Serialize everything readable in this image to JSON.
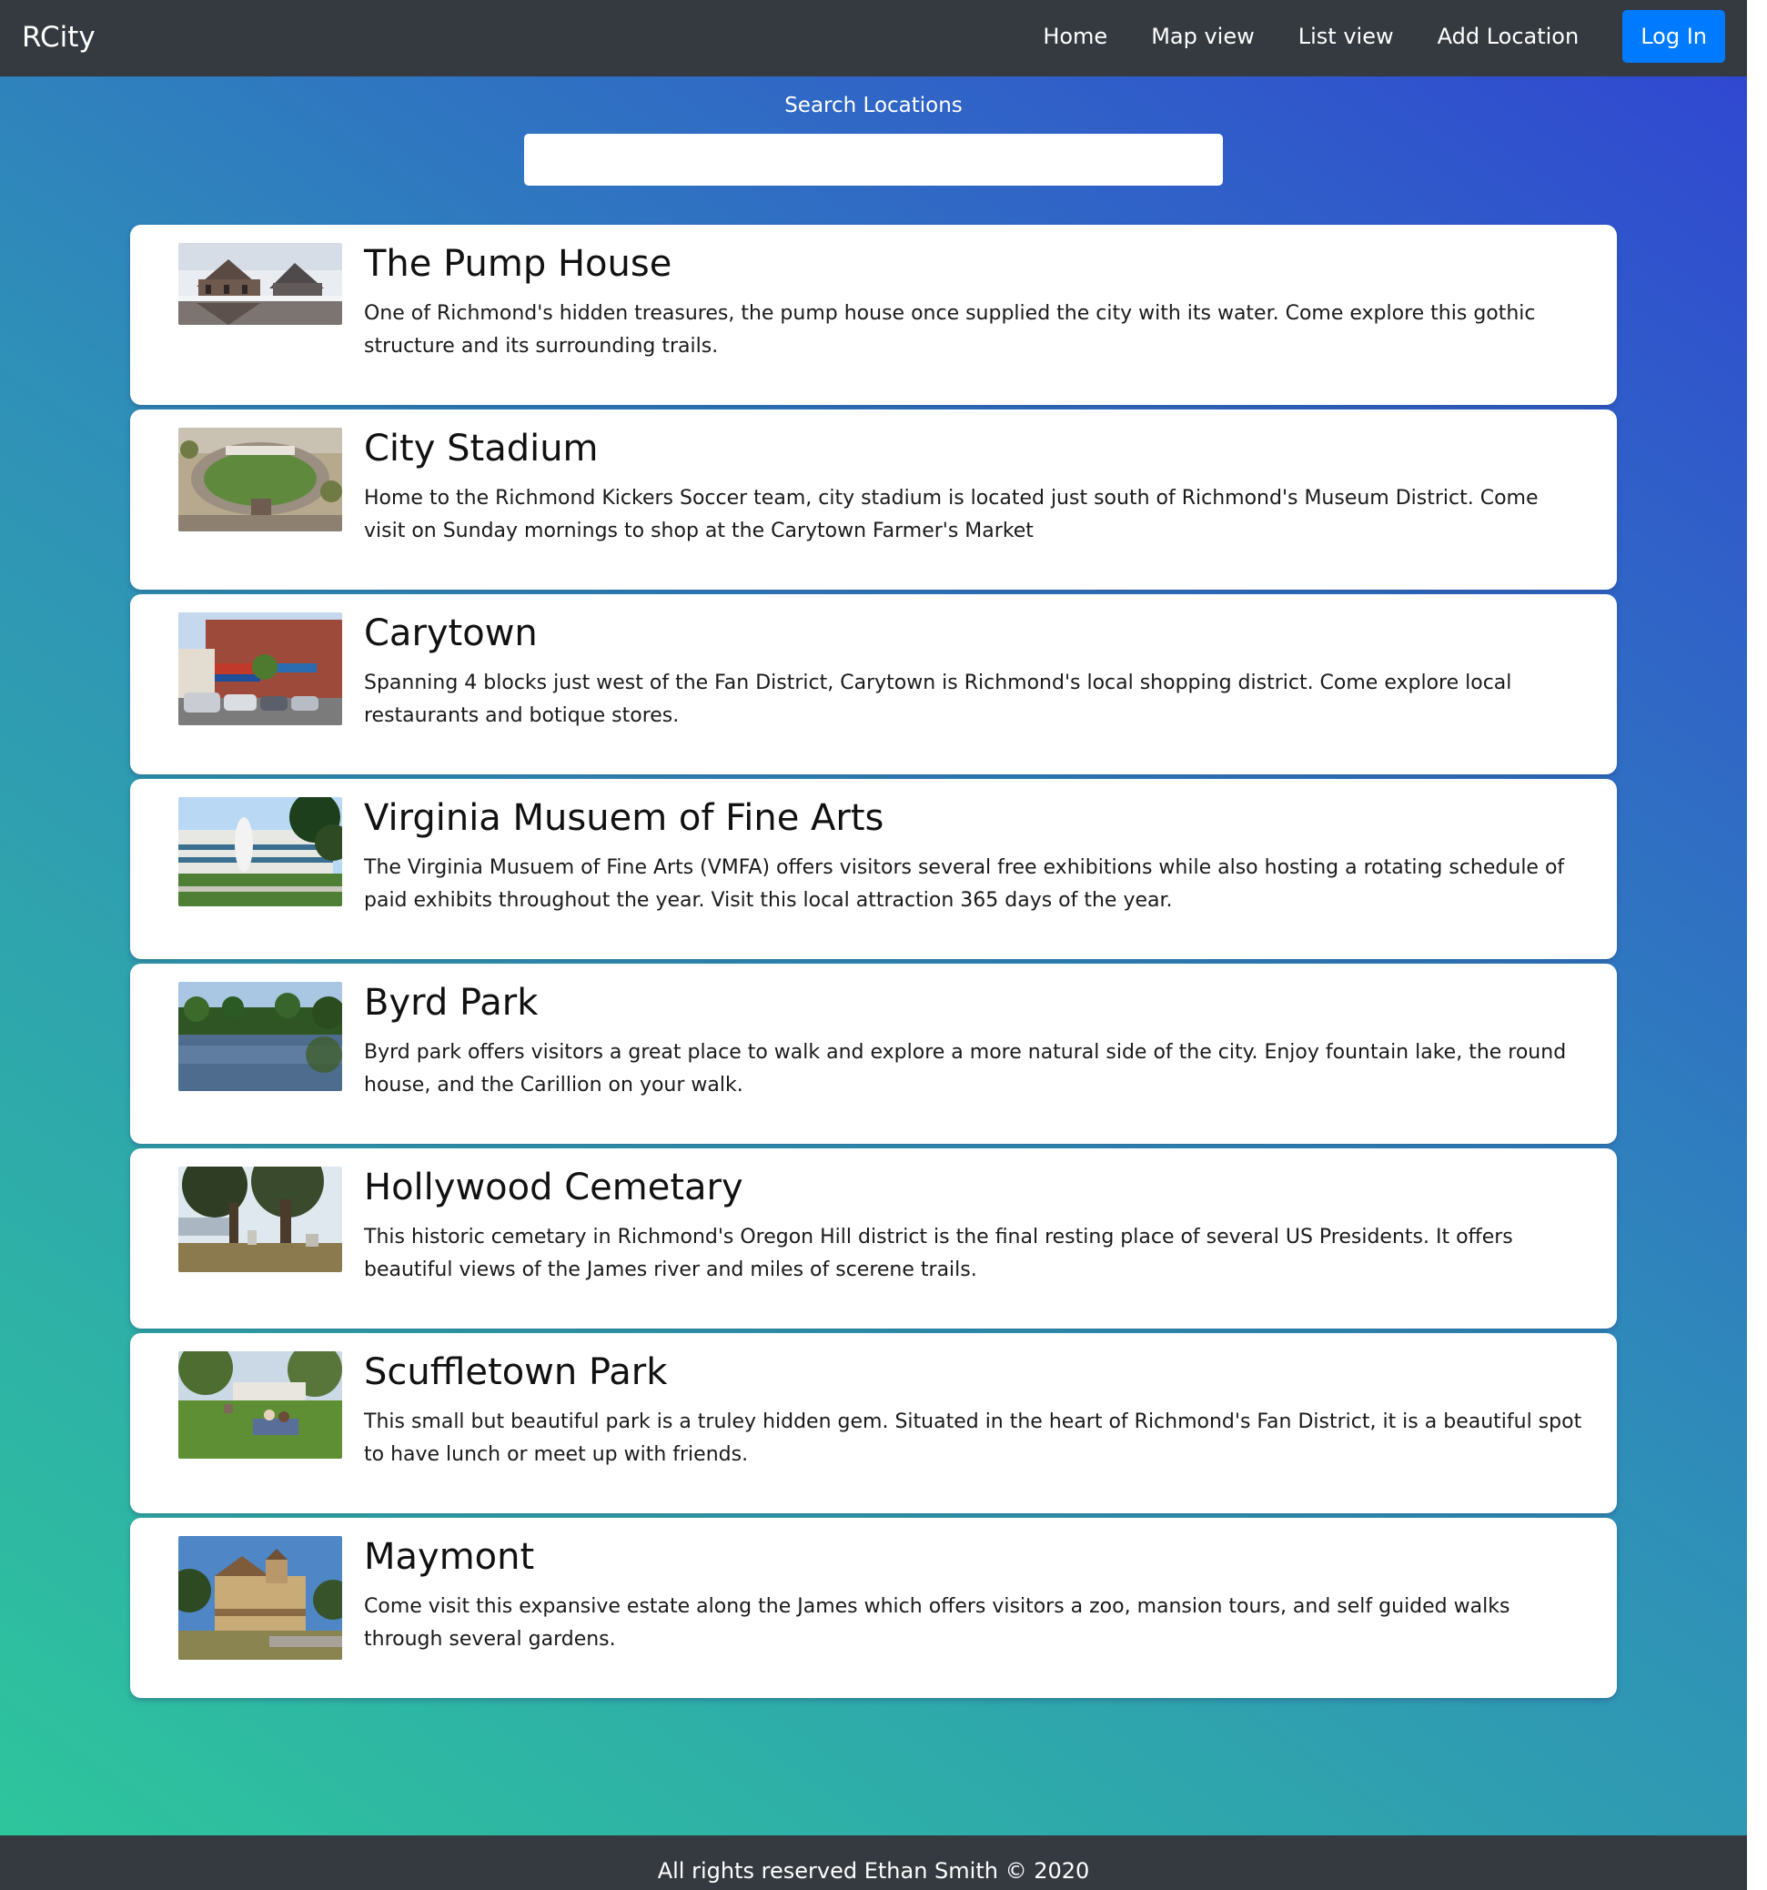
{
  "navbar": {
    "brand": "RCity",
    "links": [
      "Home",
      "Map view",
      "List view",
      "Add Location"
    ],
    "login_label": "Log In"
  },
  "search": {
    "label": "Search Locations",
    "value": ""
  },
  "locations": [
    {
      "title": "The Pump House",
      "description": "One of Richmond's hidden treasures, the pump house once supplied the city with its water. Come explore this gothic structure and its surrounding trails."
    },
    {
      "title": "City Stadium",
      "description": "Home to the Richmond Kickers Soccer team, city stadium is located just south of Richmond's Museum District. Come visit on Sunday mornings to shop at the Carytown Farmer's Market"
    },
    {
      "title": "Carytown",
      "description": "Spanning 4 blocks just west of the Fan District, Carytown is Richmond's local shopping district. Come explore local restaurants and botique stores."
    },
    {
      "title": "Virginia Musuem of Fine Arts",
      "description": "The Virginia Musuem of Fine Arts (VMFA) offers visitors several free exhibitions while also hosting a rotating schedule of paid exhibits throughout the year. Visit this local attraction 365 days of the year."
    },
    {
      "title": "Byrd Park",
      "description": "Byrd park offers visitors a great place to walk and explore a more natural side of the city. Enjoy fountain lake, the round house, and the Carillion on your walk."
    },
    {
      "title": "Hollywood Cemetary",
      "description": "This historic cemetary in Richmond's Oregon Hill district is the final resting place of several US Presidents. It offers beautiful views of the James river and miles of scerene trails."
    },
    {
      "title": "Scuffletown Park",
      "description": "This small but beautiful park is a truley hidden gem. Situated in the heart of Richmond's Fan District, it is a beautiful spot to have lunch or meet up with friends."
    },
    {
      "title": "Maymont",
      "description": "Come visit this expansive estate along the James which offers visitors a zoo, mansion tours, and self guided walks through several gardens."
    }
  ],
  "footer": {
    "text": "All rights reserved Ethan Smith © 2020"
  },
  "colors": {
    "navbar": "#343a40",
    "login": "#007bff",
    "gradient_start": "#2ec79b",
    "gradient_end": "#3044d2"
  }
}
